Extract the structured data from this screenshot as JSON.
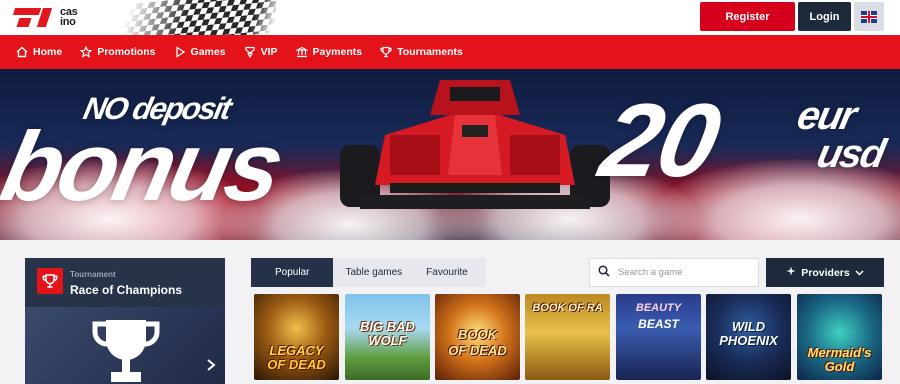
{
  "header": {
    "logo_text_top": "cas",
    "logo_text_bottom": "ino",
    "register_label": "Register",
    "login_label": "Login",
    "language_icon": "uk-flag-icon"
  },
  "nav": {
    "items": [
      {
        "label": "Home",
        "icon": "home-icon"
      },
      {
        "label": "Promotions",
        "icon": "star-icon"
      },
      {
        "label": "Games",
        "icon": "play-icon"
      },
      {
        "label": "VIP",
        "icon": "vip-icon"
      },
      {
        "label": "Payments",
        "icon": "payments-icon"
      },
      {
        "label": "Tournaments",
        "icon": "trophy-icon"
      }
    ]
  },
  "banner": {
    "line1": "NO deposit",
    "line2": "bonus",
    "amount": "20",
    "currency1": "eur",
    "currency2": "usd"
  },
  "tournament": {
    "subtitle": "Tournament",
    "title": "Race of Champions",
    "next_icon": "chevron-right-icon"
  },
  "games_filter": {
    "tabs": [
      {
        "label": "Popular",
        "active": true
      },
      {
        "label": "Table games",
        "active": false
      },
      {
        "label": "Favourite",
        "active": false
      }
    ],
    "search_placeholder": "Search a game",
    "providers_label": "Providers"
  },
  "games": [
    {
      "title_line1": "LEGACY",
      "title_line2": "OF DEAD"
    },
    {
      "title_line1": "BIG BAD",
      "title_line2": "WOLF"
    },
    {
      "title_line1": "BOOK",
      "title_line2": "OF DEAD"
    },
    {
      "title_line1": "BOOK OF RA",
      "title_line2": ""
    },
    {
      "title_line1": "BEAUTY",
      "title_line2": "BEAST"
    },
    {
      "title_line1": "WILD",
      "title_line2": "PHOENIX"
    },
    {
      "title_line1": "Mermaid's",
      "title_line2": "Gold"
    }
  ],
  "colors": {
    "brand_red": "#e4131a",
    "navy": "#1e2a3c",
    "register_red": "#d6001c"
  }
}
